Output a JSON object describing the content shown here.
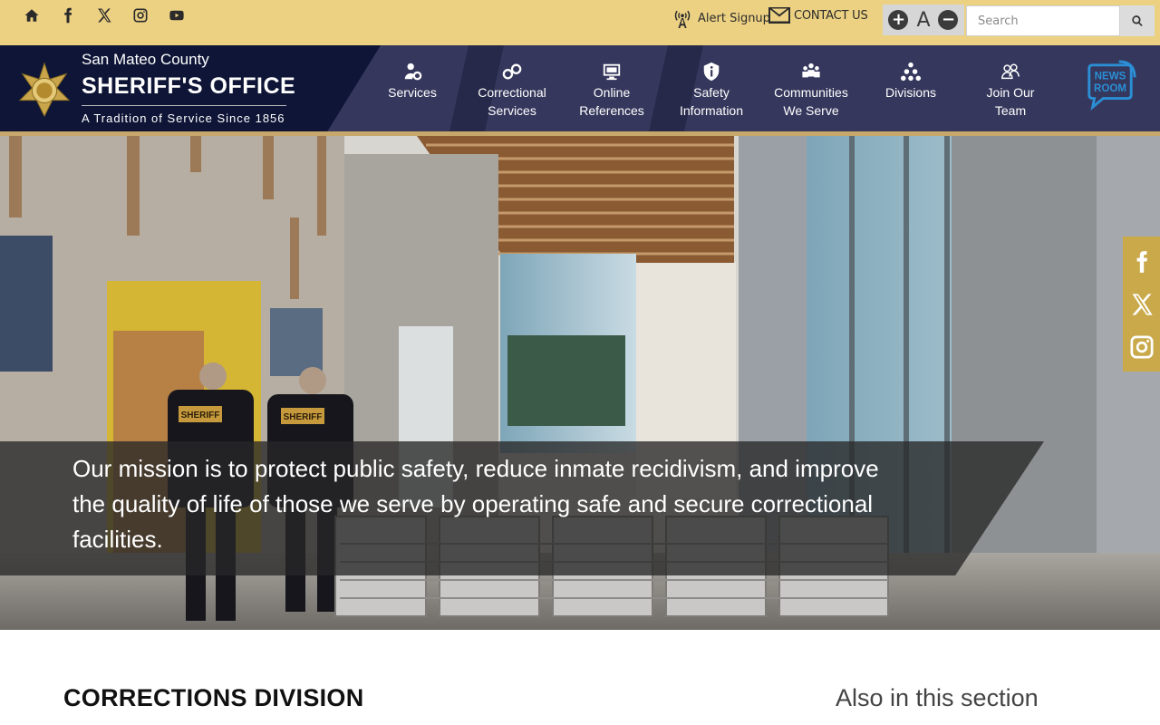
{
  "topbar": {
    "social_icons": [
      "home-icon",
      "facebook-icon",
      "x-icon",
      "instagram-icon",
      "youtube-icon"
    ],
    "alert_signup": "Alert Signup",
    "contact_us": "CONTACT US",
    "font_size": {
      "increase": "+",
      "reset": "A",
      "decrease": "−"
    },
    "search": {
      "placeholder": "Search",
      "value": ""
    }
  },
  "brand": {
    "county": "San Mateo County",
    "office": "SHERIFF'S OFFICE",
    "tagline": "A Tradition of Service Since 1856"
  },
  "nav": {
    "items": [
      {
        "line1": "Services",
        "line2": "",
        "icon": "person-gear-icon"
      },
      {
        "line1": "Correctional",
        "line2": "Services",
        "icon": "handcuffs-icon"
      },
      {
        "line1": "Online",
        "line2": "References",
        "icon": "monitor-icon"
      },
      {
        "line1": "Safety",
        "line2": "Information",
        "icon": "info-shield-icon"
      },
      {
        "line1": "Communities",
        "line2": "We Serve",
        "icon": "group-icon"
      },
      {
        "line1": "Divisions",
        "line2": "",
        "icon": "org-chart-icon"
      },
      {
        "line1": "Join Our",
        "line2": "Team",
        "icon": "people-outline-icon"
      }
    ],
    "newsroom": {
      "line1": "NEWS",
      "line2": "ROOM"
    }
  },
  "hero": {
    "mission": "Our mission is to protect public safety, reduce inmate recidivism, and improve the quality of life of those we serve by operating safe and secure correctional facilities.",
    "badge_text": "SHERIFF"
  },
  "dock": {
    "icons": [
      "facebook-icon",
      "x-icon",
      "instagram-icon"
    ]
  },
  "content": {
    "title": "CORRECTIONS DIVISION",
    "aside_title": "Also in this section"
  },
  "colors": {
    "topbar": "#ecd183",
    "nav_bg": "#35375c",
    "brand_bg": "#0e1536",
    "accent_gold": "#c7a76a",
    "dock_gold": "#c9a94a"
  }
}
